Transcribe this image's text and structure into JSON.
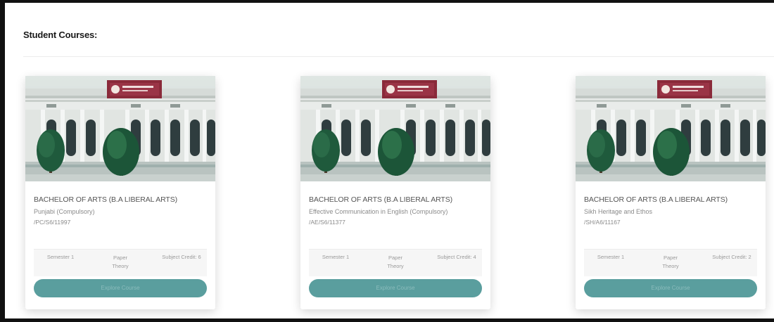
{
  "page": {
    "section_title": "Student Courses:"
  },
  "colors": {
    "button": "#5a9e9e",
    "frame": "#111111"
  },
  "cards": [
    {
      "course_title": "BACHELOR OF ARTS (B.A LIBERAL ARTS)",
      "subject_name": "Punjabi (Compulsory)",
      "subject_code": "/PC/S6/11997",
      "semester": "Semester 1",
      "paper_line1": "Paper",
      "paper_line2": "Theory",
      "subject_credit": "Subject Credit: 6",
      "button_label": "Explore Course"
    },
    {
      "course_title": "BACHELOR OF ARTS (B.A LIBERAL ARTS)",
      "subject_name": "Effective Communication in English (Compulsory)",
      "subject_code": "/AE/S6/11377",
      "semester": "Semester 1",
      "paper_line1": "Paper",
      "paper_line2": "Theory",
      "subject_credit": "Subject Credit: 4",
      "button_label": "Explore Course"
    },
    {
      "course_title": "BACHELOR OF ARTS (B.A LIBERAL ARTS)",
      "subject_name": "Sikh Heritage and Ethos",
      "subject_code": "/SH/A6/11167",
      "semester": "Semester 1",
      "paper_line1": "Paper",
      "paper_line2": "Theory",
      "subject_credit": "Subject Credit: 2",
      "button_label": "Explore Course"
    }
  ]
}
